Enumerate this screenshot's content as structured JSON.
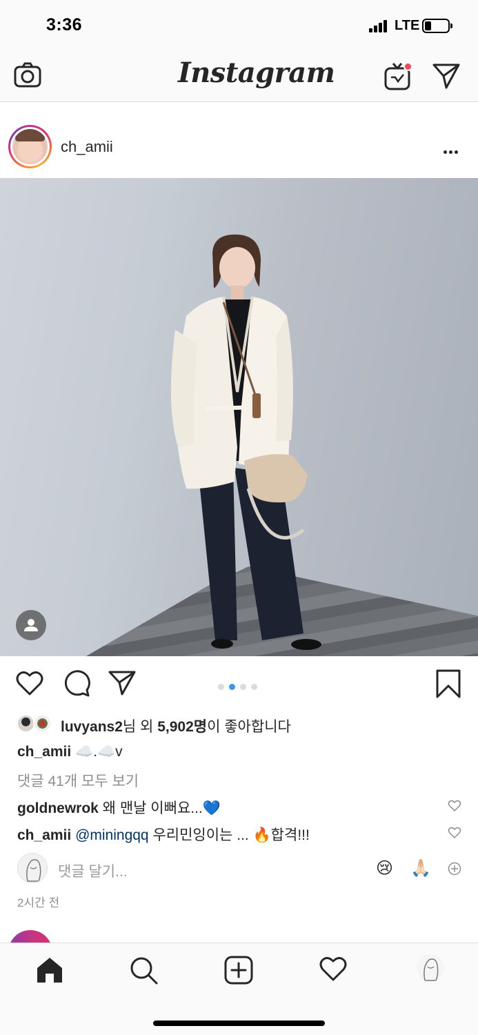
{
  "status_bar": {
    "time": "3:36",
    "network": "LTE",
    "battery_level": 0.25
  },
  "header": {
    "logo": "Instagram",
    "icons": [
      "camera-icon",
      "igtv-icon",
      "direct-message-icon"
    ],
    "igtv_badge_color": "#ed4956"
  },
  "post": {
    "author": "ch_amii",
    "carousel": {
      "count": 4,
      "active_index": 1
    },
    "likes": {
      "user": "luvyans2",
      "prefix_suffix": "님 외 ",
      "count": "5,902명",
      "suffix": "이 좋아합니다"
    },
    "caption": {
      "user": "ch_amii",
      "text": " ☁️.☁️v"
    },
    "view_all_comments": "댓글 41개 모두 보기",
    "comments": [
      {
        "user": "goldnewrok",
        "text": " 왜 맨날 이뻐요...💙"
      },
      {
        "user": "ch_amii",
        "mention": "@miningqq",
        "text": " 우리민잉이는 ... 🔥합격!!!"
      }
    ],
    "add_comment_placeholder": "댓글 달기...",
    "quick_emojis": [
      "😢",
      "🙏🏻"
    ],
    "timestamp": "2시간 전"
  },
  "tabbar": {
    "items": [
      "home-icon",
      "search-icon",
      "new-post-icon",
      "activity-heart-icon",
      "profile-avatar"
    ]
  },
  "colors": {
    "accent_blue": "#3897f0",
    "text": "#262626",
    "muted": "#8e8e8e",
    "mention": "#003569"
  }
}
